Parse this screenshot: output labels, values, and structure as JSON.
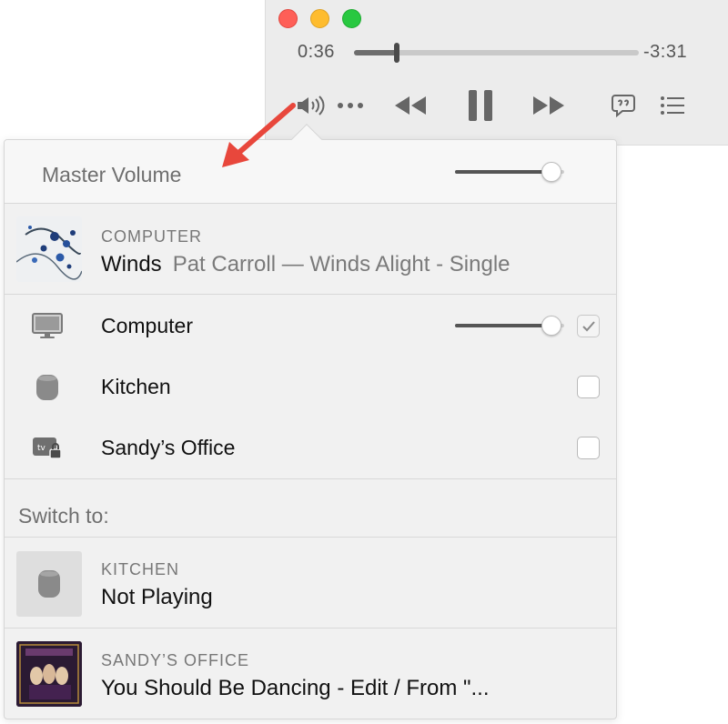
{
  "player": {
    "elapsed": "0:36",
    "remaining": "-3:31",
    "progress": 0.15,
    "colors": {
      "close": "#fe5f57",
      "minimize": "#febc2e",
      "zoom": "#28c840"
    },
    "controls": [
      "speaker-icon",
      "more-icon",
      "rewind-icon",
      "pause-icon",
      "fast-forward-icon",
      "lyrics-icon",
      "queue-icon"
    ]
  },
  "master": {
    "label": "Master Volume",
    "volume": 0.88
  },
  "now_playing": {
    "caption": "COMPUTER",
    "title": "Winds",
    "subtitle": "Pat Carroll — Winds Alight - Single"
  },
  "devices": [
    {
      "name": "Computer",
      "icon": "computer-display-icon",
      "checked": true,
      "volume": 0.88
    },
    {
      "name": "Kitchen",
      "icon": "homepod-icon",
      "checked": false
    },
    {
      "name": "Sandy’s Office",
      "icon": "apple-tv-locked-icon",
      "checked": false
    }
  ],
  "switch_to": {
    "label": "Switch to:",
    "targets": [
      {
        "caption": "KITCHEN",
        "title": "Not Playing",
        "icon": "homepod-icon"
      },
      {
        "caption": "SANDY’S OFFICE",
        "title": "You Should Be Dancing - Edit / From \"..."
      }
    ]
  },
  "annotation": {
    "color": "#e8473c"
  }
}
